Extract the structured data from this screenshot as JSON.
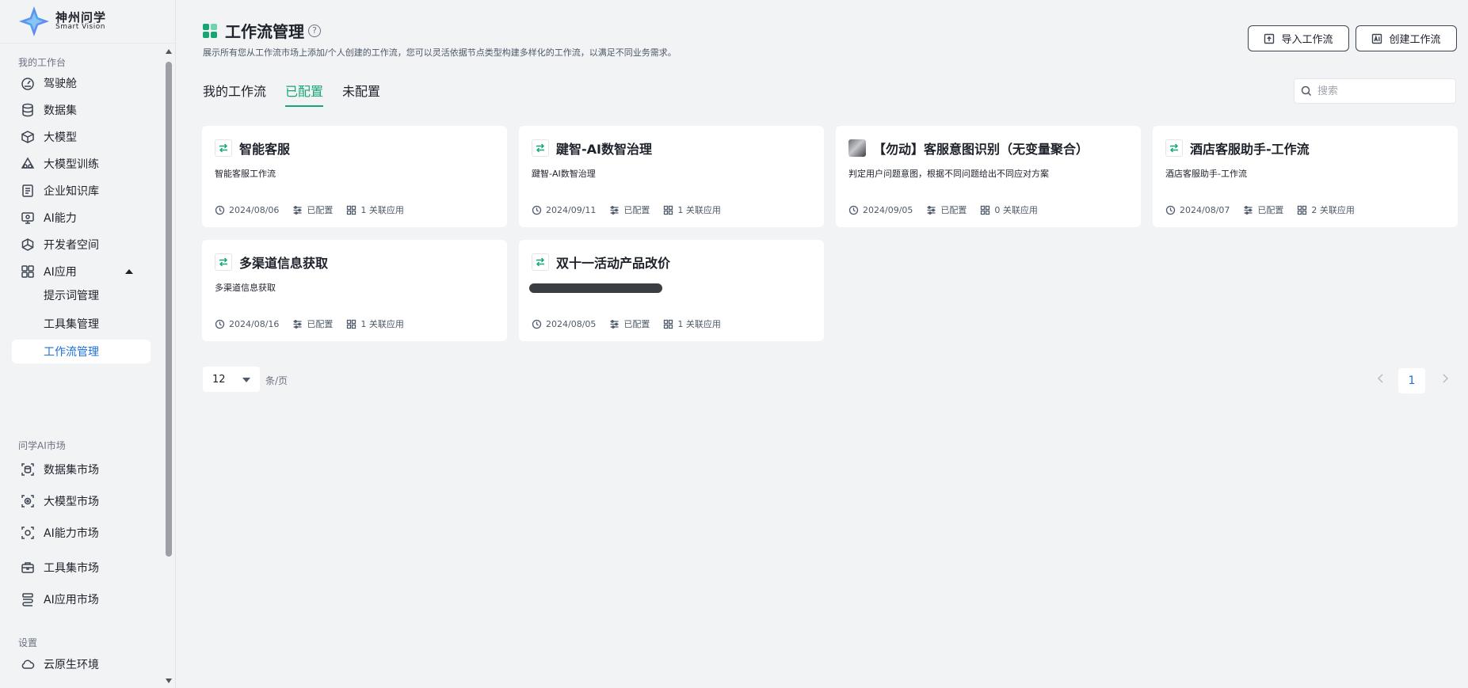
{
  "brand": {
    "name_cn": "神州问学",
    "name_en": "Smart Vision"
  },
  "sidebar": {
    "section_workspace": "我的工作台",
    "section_market": "问学AI市场",
    "section_settings": "设置",
    "items": [
      {
        "label": "驾驶舱",
        "icon": "dashboard-icon"
      },
      {
        "label": "数据集",
        "icon": "database-icon"
      },
      {
        "label": "大模型",
        "icon": "cube-icon"
      },
      {
        "label": "大模型训练",
        "icon": "training-icon"
      },
      {
        "label": "企业知识库",
        "icon": "knowledge-icon"
      },
      {
        "label": "AI能力",
        "icon": "monitor-icon"
      },
      {
        "label": "开发者空间",
        "icon": "dev-icon"
      },
      {
        "label": "AI应用",
        "icon": "apps-icon"
      }
    ],
    "sub_items": [
      {
        "label": "提示词管理"
      },
      {
        "label": "工具集管理"
      },
      {
        "label": "工作流管理"
      }
    ],
    "market_items": [
      {
        "label": "数据集市场"
      },
      {
        "label": "大模型市场"
      },
      {
        "label": "AI能力市场"
      },
      {
        "label": "工具集市场"
      },
      {
        "label": "AI应用市场"
      }
    ],
    "settings_items": [
      {
        "label": "云原生环境"
      }
    ]
  },
  "header": {
    "title": "工作流管理",
    "subtitle": "展示所有您从工作流市场上添加/个人创建的工作流，您可以灵活依据节点类型构建多样化的工作流，以满足不同业务需求。",
    "import_label": "导入工作流",
    "create_label": "创建工作流"
  },
  "tabs": [
    {
      "label": "我的工作流",
      "active": false
    },
    {
      "label": "已配置",
      "active": true
    },
    {
      "label": "未配置",
      "active": false
    }
  ],
  "search": {
    "placeholder": "搜索"
  },
  "cards": [
    {
      "title": "智能客服",
      "desc": "智能客服工作流",
      "date": "2024/08/06",
      "status": "已配置",
      "apps": "1 关联应用"
    },
    {
      "title": "踺智-AI数智治理",
      "desc": "踺智-AI数智治理",
      "date": "2024/09/11",
      "status": "已配置",
      "apps": "1 关联应用"
    },
    {
      "title": "【勿动】客服意图识别（无变量聚合）",
      "desc": "判定用户问题意图，根据不同问题给出不同应对方案",
      "date": "2024/09/05",
      "status": "已配置",
      "apps": "0 关联应用"
    },
    {
      "title": "酒店客服助手-工作流",
      "desc": "酒店客服助手-工作流",
      "date": "2024/08/07",
      "status": "已配置",
      "apps": "2 关联应用"
    },
    {
      "title": "多渠道信息获取",
      "desc": "多渠道信息获取",
      "date": "2024/08/16",
      "status": "已配置",
      "apps": "1 关联应用"
    },
    {
      "title": "双十一活动产品改价",
      "desc": "",
      "date": "2024/08/05",
      "status": "已配置",
      "apps": "1 关联应用"
    }
  ],
  "pagination": {
    "page_size": "12",
    "unit": "条/页",
    "current_page": "1"
  },
  "colors": {
    "accent": "#17a673",
    "link": "#1d6fd8",
    "background": "#f2f3f5"
  }
}
